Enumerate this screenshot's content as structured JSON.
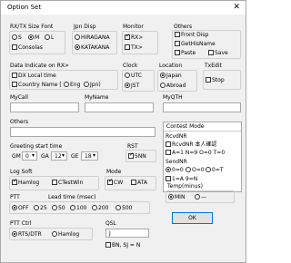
{
  "window": {
    "title": "Option Set",
    "close": "✕"
  },
  "rxtx_font": {
    "label": "RX/TX Size Font",
    "options": [
      "S",
      "M",
      "L"
    ],
    "selected": "M",
    "consolas": "Consolas"
  },
  "jpn_disp": {
    "label": "Jpn Disp",
    "hiragana": "HIRAGANA",
    "katakana": "KATAKANA",
    "selected": "KATAKANA"
  },
  "monitor": {
    "label": "Monitor",
    "rx": "RX>",
    "tx": "TX>"
  },
  "others_top": {
    "label": "Others",
    "front_disp": "Front Disp",
    "get_his_name": "GetHisName",
    "paste": "Paste",
    "save": "Save"
  },
  "data_indicate": {
    "label": "Data Indicate on RX>",
    "local_time": "DX Local time",
    "country_name": "Country Name [",
    "eng": "Eng",
    "jpn": "Jpn)"
  },
  "clock": {
    "label": "Clock",
    "utc": "UTC",
    "jst": "JST",
    "selected": "JST"
  },
  "location": {
    "label": "Location",
    "japan": "Japan",
    "abroad": "Abroad",
    "selected": "Japan"
  },
  "txedit": {
    "label": "TxEdit",
    "stop": "Stop"
  },
  "mycall": {
    "label": "MyCall",
    "value": ""
  },
  "myname": {
    "label": "MyName",
    "value": ""
  },
  "myqth": {
    "label": "MyQTH",
    "value": ""
  },
  "others_field": {
    "label": "Others",
    "value": ""
  },
  "greeting": {
    "label": "Greeting start time",
    "gm_label": "GM",
    "gm_value": "0",
    "ga_label": "GA",
    "ga_value": "12",
    "ge_label": "GE",
    "ge_value": "18"
  },
  "rst": {
    "label": "RST",
    "value": "5NN"
  },
  "log_soft": {
    "label": "Log Soft",
    "hamlog": "Hamlog",
    "ctestwin": "CTestWin"
  },
  "mode": {
    "label": "Mode",
    "cw": "CW",
    "ata": "ATA"
  },
  "contest": {
    "label": "Contest Mode",
    "rcv_label": "RcvdNR",
    "rcvd_only": "RcvdNR 本人確認",
    "rcvd_opts": [
      "A=1",
      "N=9",
      "O=0",
      "T=0"
    ],
    "send_label": "SendNR",
    "send_opts": [
      "0=0",
      "O=0",
      "0=T",
      "0=T"
    ],
    "send_opts2": [
      "1=A",
      "9=N"
    ]
  },
  "ptt": {
    "label": "PTT",
    "lead_label": "Lead time (msec)",
    "options": [
      "OFF",
      "25",
      "50",
      "100",
      "200",
      "500"
    ],
    "selected": "OFF"
  },
  "temp": {
    "label": "Temp(minus)",
    "min": "MIN",
    "dash": "—",
    "selected": "MIN"
  },
  "ptt_ctrl": {
    "label": "PTT Ctrl",
    "rts_dtr": "RTS/DTR",
    "hamlog": "Hamlog",
    "selected": "RTS/DTR"
  },
  "qsl": {
    "label": "QSL",
    "value": "J",
    "bn_sj": "BN, SJ = N"
  },
  "ok": {
    "label": "OK"
  }
}
